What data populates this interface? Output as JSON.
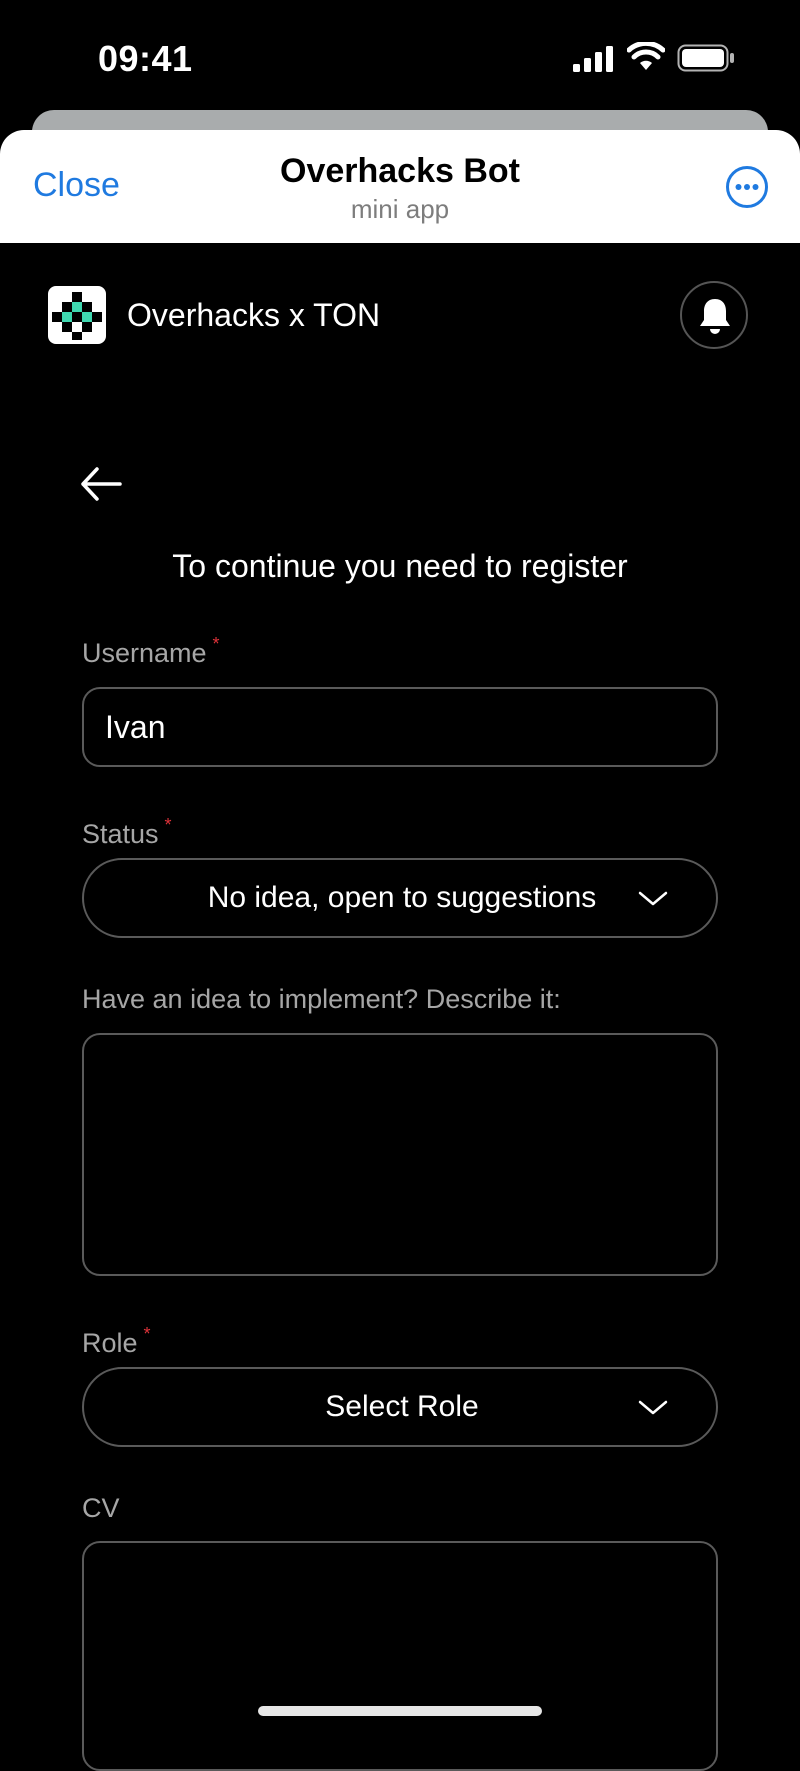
{
  "status_bar": {
    "time": "09:41"
  },
  "header": {
    "close_label": "Close",
    "title": "Overhacks Bot",
    "subtitle": "mini app"
  },
  "app": {
    "name": "Overhacks x TON"
  },
  "form": {
    "heading": "To continue you need to register",
    "username": {
      "label": "Username",
      "required_mark": "*",
      "value": "Ivan"
    },
    "status": {
      "label": "Status",
      "required_mark": "*",
      "value": "No idea, open to suggestions"
    },
    "idea": {
      "label": "Have an idea to implement? Describe it:",
      "value": ""
    },
    "role": {
      "label": "Role",
      "required_mark": "*",
      "value": "Select Role"
    },
    "cv": {
      "label": "CV",
      "value": ""
    }
  },
  "colors": {
    "accent": "#1f7ae0",
    "required": "#e0333a",
    "logo_accent": "#3fd8b0"
  }
}
